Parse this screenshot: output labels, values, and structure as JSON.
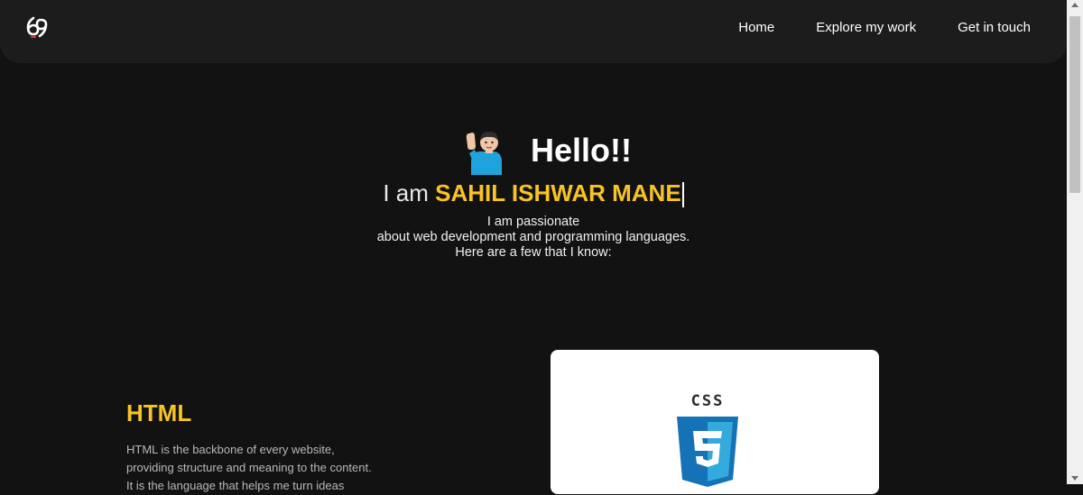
{
  "navbar": {
    "logo_icon": "logo-69-icon",
    "links": [
      {
        "label": "Home"
      },
      {
        "label": "Explore my work"
      },
      {
        "label": "Get in touch"
      }
    ]
  },
  "hero": {
    "wave_icon": "person-waving-icon",
    "greeting": "Hello!!",
    "iam_prefix": "I am ",
    "name": "SAHIL ISHWAR MANE",
    "intro_lines": [
      "I am passionate",
      "about web development and programming languages.",
      "Here are a few that I know:"
    ]
  },
  "skill": {
    "title": "HTML",
    "description_lines": [
      "HTML is the backbone of every website,",
      "providing structure and meaning to the content.",
      "It is the language that helps me turn ideas"
    ],
    "card_icon": "css3-logo-icon",
    "card_label": "CSS"
  },
  "colors": {
    "background": "#121212",
    "navbar": "#1c1c1c",
    "accent": "#f7c325",
    "css_blue": "#1572b6"
  }
}
